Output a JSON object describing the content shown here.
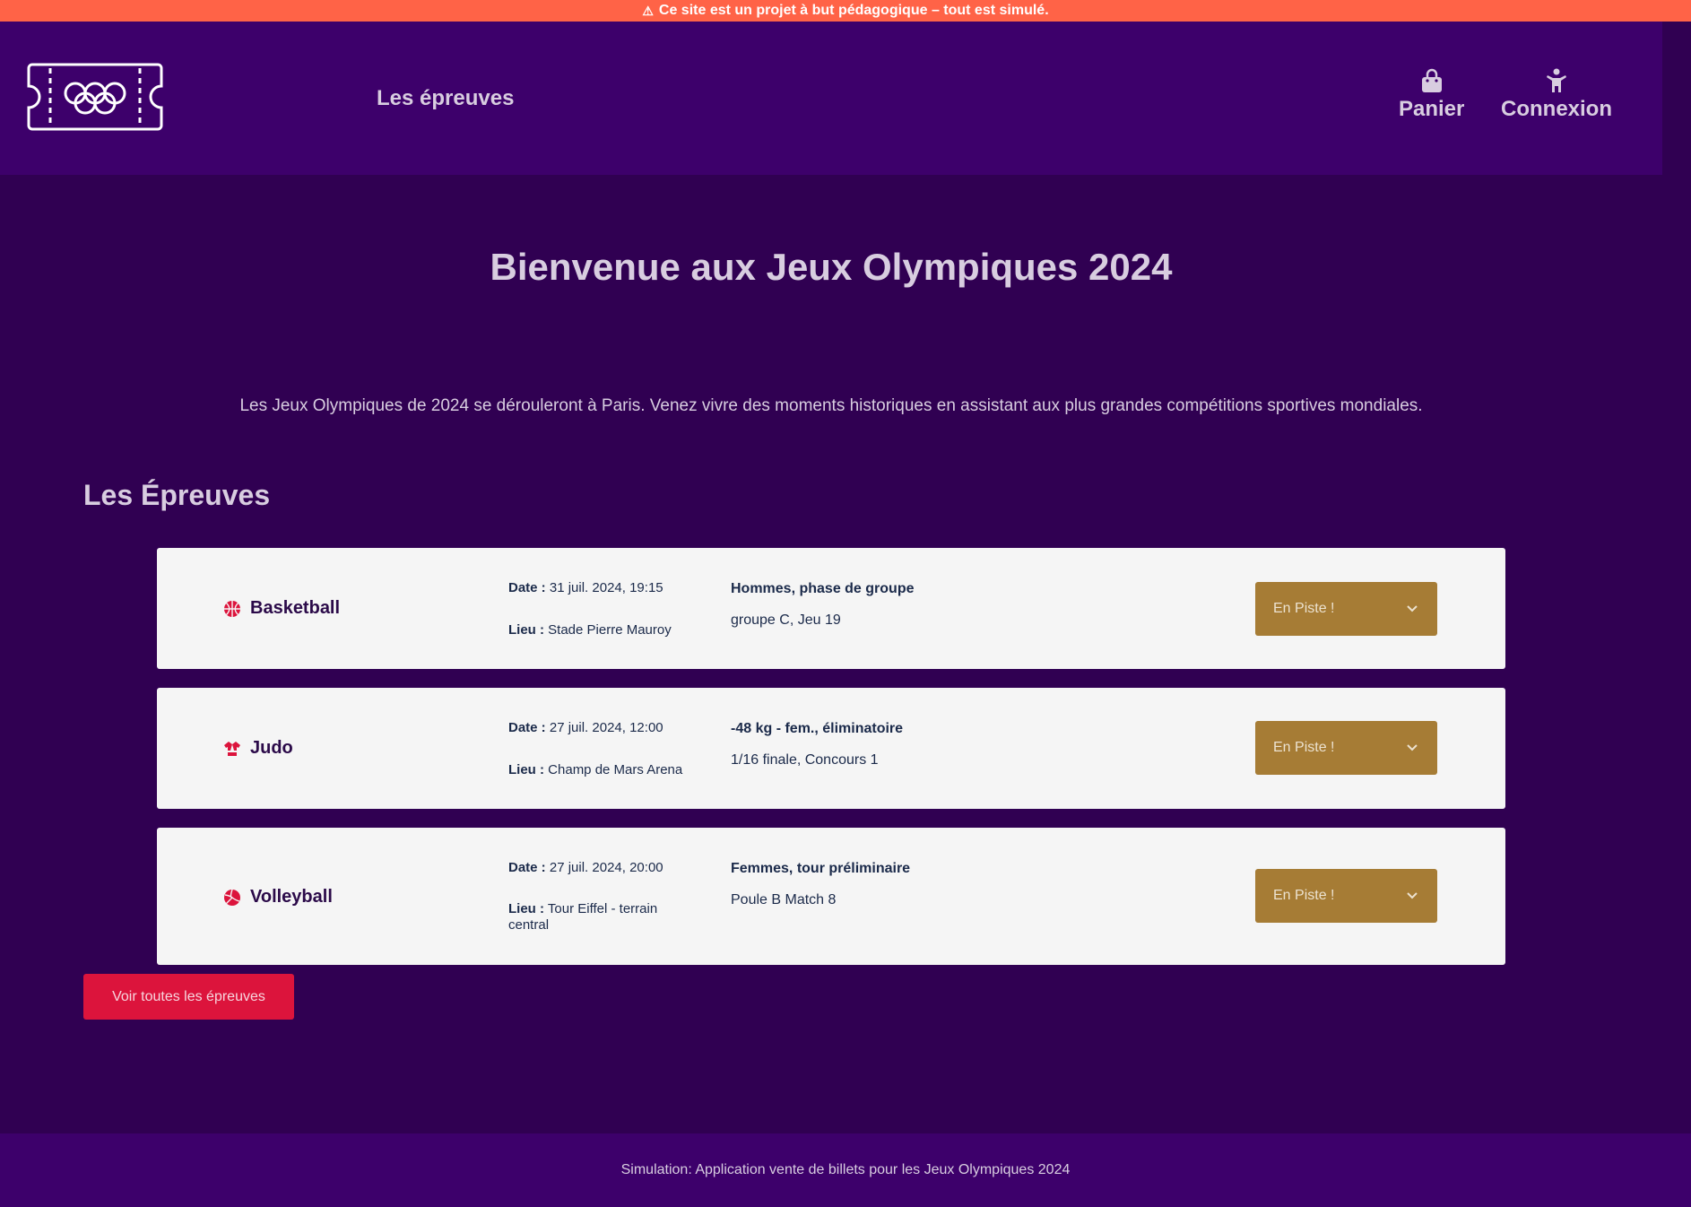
{
  "banner": {
    "icon": "warning-icon",
    "text": "Ce site est un projet à but pédagogique – tout est simulé."
  },
  "header": {
    "logo": "olympic-ticket-logo",
    "nav_link": "Les épreuves",
    "cart_label": "Panier",
    "cart_icon": "shopping-bag-icon",
    "login_label": "Connexion",
    "login_icon": "person-icon"
  },
  "hero": {
    "title": "Bienvenue aux Jeux Olympiques 2024",
    "intro": "Les Jeux Olympiques de 2024 se dérouleront à Paris. Venez vivre des moments historiques en assistant aux plus grandes compétitions sportives mondiales."
  },
  "events": {
    "heading": "Les Épreuves",
    "date_label": "Date :",
    "lieu_label": "Lieu :",
    "items": [
      {
        "sport": "Basketball",
        "icon": "basketball-icon",
        "date": "31 juil. 2024, 19:15",
        "lieu": "Stade Pierre Mauroy",
        "phase": "Hommes, phase de groupe",
        "detail": "groupe C, Jeu 19",
        "select": "En Piste !"
      },
      {
        "sport": "Judo",
        "icon": "judo-icon",
        "date": "27 juil. 2024, 12:00",
        "lieu": "Champ de Mars Arena",
        "phase": "-48 kg - fem., éliminatoire",
        "detail": "1/16 finale, Concours 1",
        "select": "En Piste !"
      },
      {
        "sport": "Volleyball",
        "icon": "volleyball-icon",
        "date": "27 juil. 2024, 20:00",
        "lieu": "Tour Eiffel - terrain central",
        "phase": "Femmes, tour préliminaire",
        "detail": "Poule B Match 8",
        "select": "En Piste !"
      }
    ],
    "all_button": "Voir toutes les épreuves"
  },
  "footer": {
    "text": "Simulation: Application vente de billets pour les Jeux Olympiques 2024"
  },
  "colors": {
    "banner": "#ff6347",
    "header": "#3d006b",
    "background": "#300052",
    "card": "#f5f5f5",
    "select": "#a67c35",
    "button": "#dc143c"
  }
}
